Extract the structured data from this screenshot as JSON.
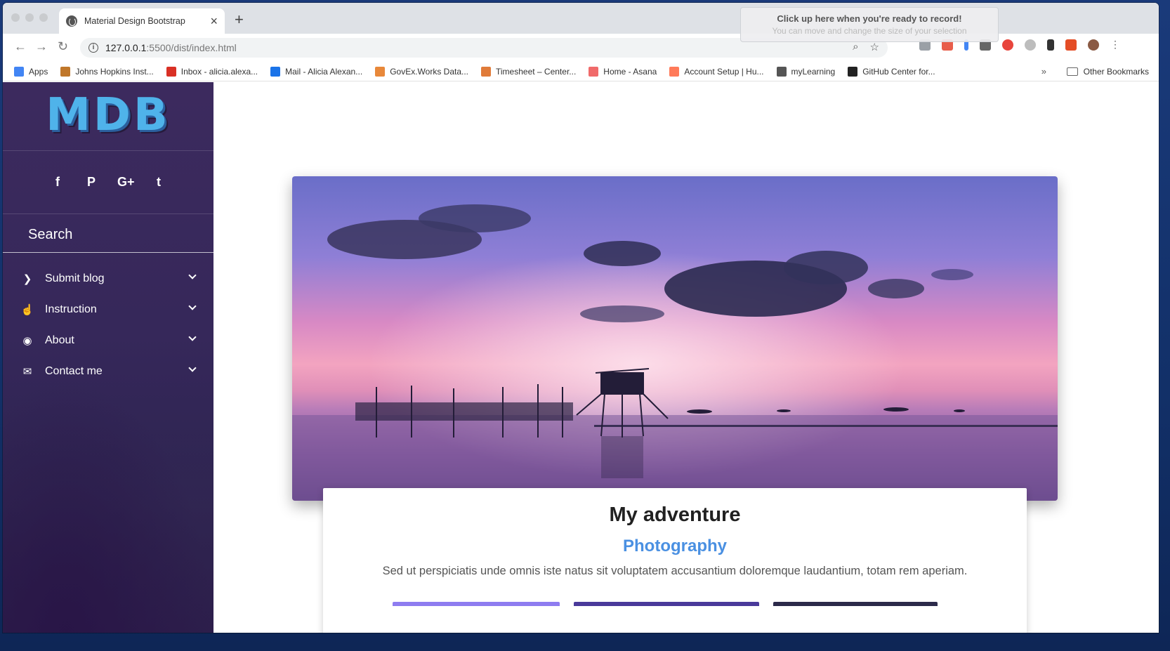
{
  "browser": {
    "tab_title": "Material Design Bootstrap",
    "url_host": "127.0.0.1",
    "url_path": ":5500/dist/index.html",
    "recorder": {
      "line1": "Click up here when you're ready to record!",
      "line2": "You can move and change the size of your selection"
    },
    "bookmarks": [
      {
        "label": "Apps",
        "color": "#4285f4"
      },
      {
        "label": "Johns Hopkins Inst...",
        "color": "#c0772a"
      },
      {
        "label": "Inbox - alicia.alexa...",
        "color": "#d93025"
      },
      {
        "label": "Mail - Alicia Alexan...",
        "color": "#1a73e8"
      },
      {
        "label": "GovEx.Works Data...",
        "color": "#e8883a"
      },
      {
        "label": "Timesheet – Center...",
        "color": "#e07b39"
      },
      {
        "label": "Home - Asana",
        "color": "#f06a6a"
      },
      {
        "label": "Account Setup | Hu...",
        "color": "#ff7a59"
      },
      {
        "label": "myLearning",
        "color": "#555555"
      },
      {
        "label": "GitHub Center for...",
        "color": "#222222"
      }
    ],
    "bookmarks_more": "»",
    "other_bookmarks": "Other Bookmarks"
  },
  "sidebar": {
    "logo": "MDB",
    "social": [
      "f",
      "P",
      "G+",
      "t"
    ],
    "search_placeholder": "Search",
    "menu": [
      {
        "label": "Submit blog",
        "icon": "chevron-right-icon",
        "glyph": "❯"
      },
      {
        "label": "Instruction",
        "icon": "hand-pointer-icon",
        "glyph": "☝"
      },
      {
        "label": "About",
        "icon": "eye-icon",
        "glyph": "◉"
      },
      {
        "label": "Contact me",
        "icon": "envelope-icon",
        "glyph": "✉"
      }
    ]
  },
  "card": {
    "title": "My adventure",
    "subtitle": "Photography",
    "text": "Sed ut perspiciatis unde omnis iste natus sit voluptatem accusantium doloremque laudantium, totam rem aperiam."
  },
  "colors": {
    "sidebar_bg": "#36285a",
    "logo_blue": "#4fb3ea",
    "subtitle_blue": "#4a90e2",
    "button_purple": "#8e7cf0",
    "button_indigo": "#4a3a9a",
    "button_dark": "#2c2a4a"
  }
}
